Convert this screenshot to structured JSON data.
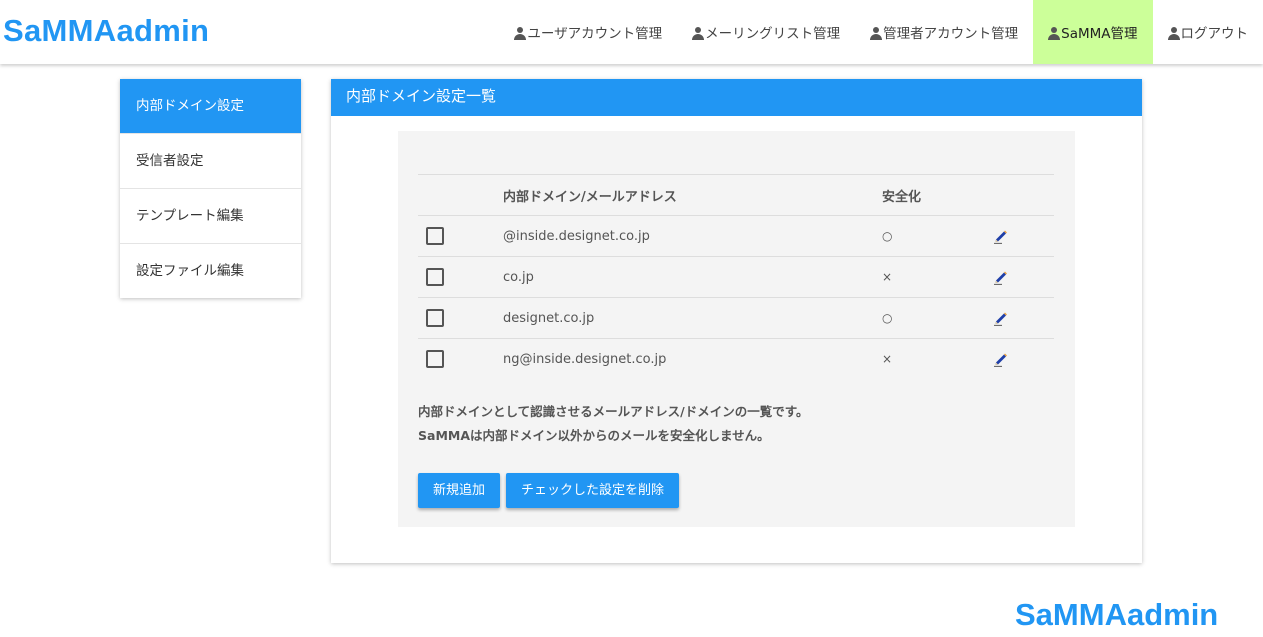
{
  "header": {
    "logo": "SaMMAadmin",
    "nav": [
      {
        "label": "ユーザアカウント管理",
        "active": false
      },
      {
        "label": "メーリングリスト管理",
        "active": false
      },
      {
        "label": "管理者アカウント管理",
        "active": false
      },
      {
        "label": "SaMMA管理",
        "active": true
      },
      {
        "label": "ログアウト",
        "active": false
      }
    ]
  },
  "sidebar": {
    "items": [
      {
        "label": "内部ドメイン設定",
        "active": true
      },
      {
        "label": "受信者設定",
        "active": false
      },
      {
        "label": "テンプレート編集",
        "active": false
      },
      {
        "label": "設定ファイル編集",
        "active": false
      }
    ]
  },
  "main": {
    "title": "内部ドメイン設定一覧",
    "table": {
      "columns": [
        "",
        "内部ドメイン/メールアドレス",
        "安全化",
        ""
      ],
      "rows": [
        {
          "address": "@inside.designet.co.jp",
          "secure": "○"
        },
        {
          "address": "co.jp",
          "secure": "×"
        },
        {
          "address": "designet.co.jp",
          "secure": "○"
        },
        {
          "address": "ng@inside.designet.co.jp",
          "secure": "×"
        }
      ]
    },
    "description": [
      "内部ドメインとして認識させるメールアドレス/ドメインの一覧です。",
      "SaMMAは内部ドメイン以外からのメールを安全化しません。"
    ],
    "add_button": "新規追加",
    "delete_button": "チェックした設定を削除"
  },
  "footer": {
    "logo": "SaMMAadmin"
  },
  "colors": {
    "accent": "#2196f3",
    "active_nav": "#ccff99"
  }
}
